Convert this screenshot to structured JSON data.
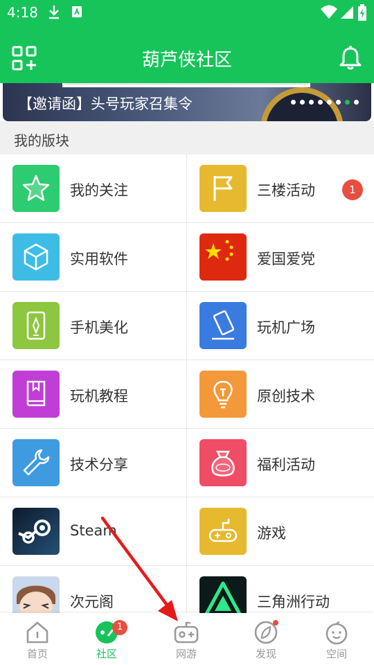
{
  "status_bar": {
    "time": "4:18",
    "icons": [
      "download-icon",
      "sim-icon",
      "wifi-icon",
      "signal-icon",
      "battery-charging-icon"
    ]
  },
  "header": {
    "title": "葫芦侠社区",
    "left_icon": "apps-add-icon",
    "right_icon": "bell-icon",
    "color": "#16c45a"
  },
  "banner": {
    "text": "【邀请函】头号玩家召集令",
    "dot_count": 8,
    "active_dot": 6
  },
  "section": {
    "title": "我的版块"
  },
  "boards": [
    {
      "name": "我的关注",
      "icon": "star-icon",
      "color": "#2ecc71"
    },
    {
      "name": "三楼活动",
      "icon": "flag-icon",
      "color": "#e6b92f",
      "badge": "1"
    },
    {
      "name": "实用软件",
      "icon": "cube-icon",
      "color": "#3dbde6"
    },
    {
      "name": "爱国爱党",
      "icon": "china-flag-icon",
      "color": "#de2910"
    },
    {
      "name": "手机美化",
      "icon": "phone-compass-icon",
      "color": "#8dc63f"
    },
    {
      "name": "玩机广场",
      "icon": "tilted-phone-icon",
      "color": "#3a7be0"
    },
    {
      "name": "玩机教程",
      "icon": "book-icon",
      "color": "#c03ed6"
    },
    {
      "name": "原创技术",
      "icon": "bulb-icon",
      "color": "#f3993b"
    },
    {
      "name": "技术分享",
      "icon": "wrench-icon",
      "color": "#3f9be0"
    },
    {
      "name": "福利活动",
      "icon": "money-bag-icon",
      "color": "#ef4d66"
    },
    {
      "name": "Steam",
      "icon": "steam-icon",
      "color": "#1b2838"
    },
    {
      "name": "游戏",
      "icon": "gamepad-icon",
      "color": "#e6b92f"
    },
    {
      "name": "次元阁",
      "icon": "anime-avatar-icon",
      "color": "#c9d8ec"
    },
    {
      "name": "三角洲行动",
      "icon": "delta-logo-icon",
      "color": "#0d1a1a"
    }
  ],
  "tabs": [
    {
      "label": "首页",
      "icon": "home-icon"
    },
    {
      "label": "社区",
      "icon": "community-icon",
      "active": true,
      "badge": "1"
    },
    {
      "label": "网游",
      "icon": "game-controller-icon"
    },
    {
      "label": "发现",
      "icon": "compass-icon",
      "dot": true
    },
    {
      "label": "空间",
      "icon": "smiley-icon"
    }
  ]
}
